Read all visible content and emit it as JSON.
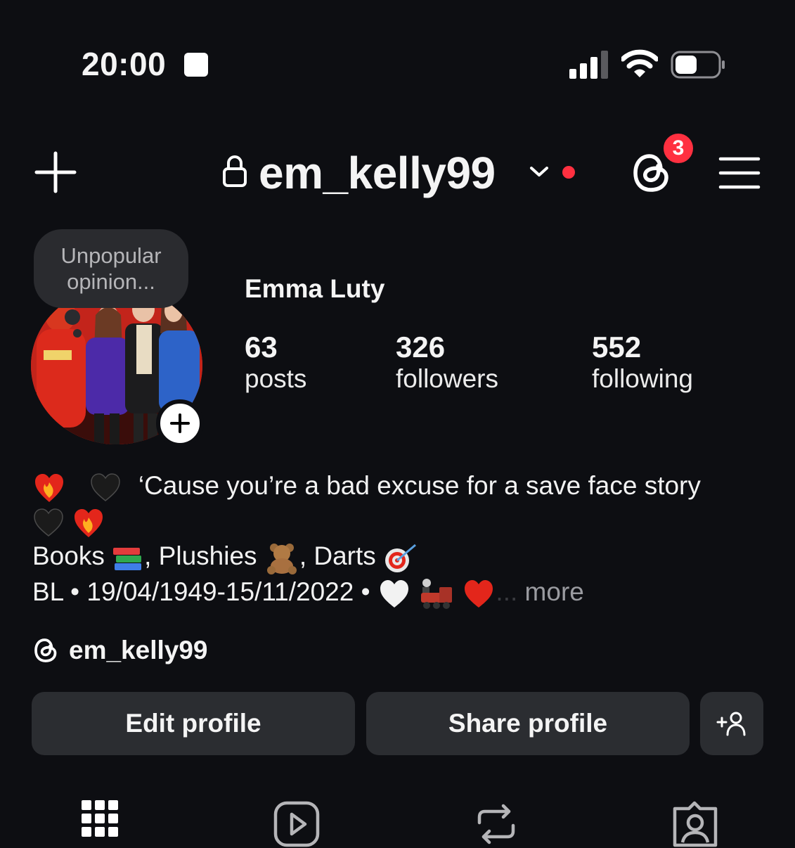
{
  "status_bar": {
    "time": "20:00"
  },
  "header": {
    "username": "em_kelly99",
    "notifications_badge": "3"
  },
  "profile": {
    "note": [
      "Unpopular",
      "opinion..."
    ],
    "full_name": "Emma Luty",
    "stats": [
      {
        "value": "63",
        "label": "posts"
      },
      {
        "value": "326",
        "label": "followers"
      },
      {
        "value": "552",
        "label": "following"
      }
    ],
    "bio": {
      "line1": "‘Cause you’re a bad excuse for a save face story",
      "line2_a": "Books",
      "line2_b": ", Plushies",
      "line2_c": ", Darts",
      "line3": "BL • 19/04/1949-15/11/2022 •",
      "more": "more"
    },
    "threads_handle": "em_kelly99"
  },
  "buttons": {
    "edit": "Edit profile",
    "share": "Share profile"
  },
  "colors": {
    "background": "#0d0e12",
    "button": "#2b2d31",
    "badge": "#ff3040"
  },
  "icons": [
    "plus-icon",
    "lock-icon",
    "chevron-down-icon",
    "threads-icon",
    "menu-icon",
    "add-person-icon",
    "grid-icon",
    "reels-icon",
    "reposts-icon",
    "tagged-icon"
  ]
}
